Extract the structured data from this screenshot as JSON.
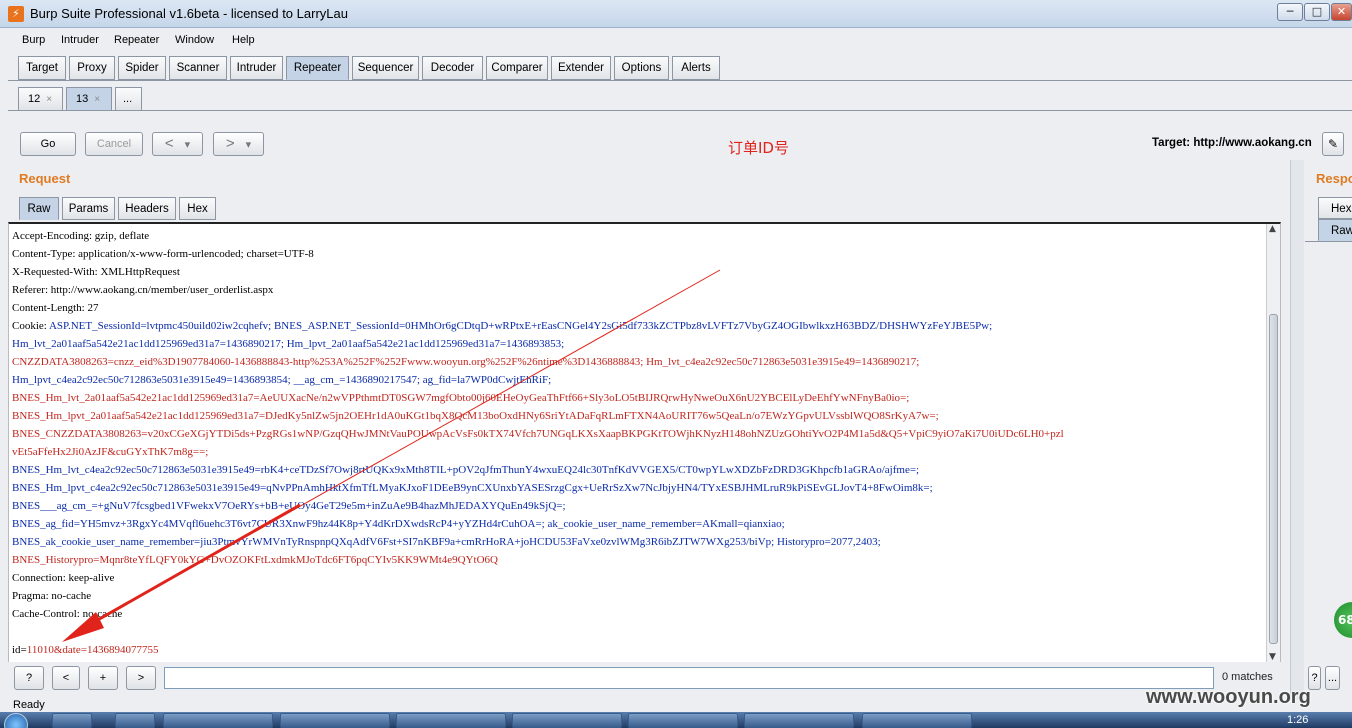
{
  "window": {
    "title": "Burp Suite Professional v1.6beta - licensed to LarryLau",
    "minimize": "─",
    "maximize": "□",
    "close": "✕"
  },
  "menu": [
    "Burp",
    "Intruder",
    "Repeater",
    "Window",
    "Help"
  ],
  "main_tabs": [
    "Target",
    "Proxy",
    "Spider",
    "Scanner",
    "Intruder",
    "Repeater",
    "Sequencer",
    "Decoder",
    "Comparer",
    "Extender",
    "Options",
    "Alerts"
  ],
  "active_main_tab": "Repeater",
  "sub_tabs": [
    {
      "label": "12",
      "close": "×"
    },
    {
      "label": "13",
      "close": "×"
    },
    {
      "label": "..."
    }
  ],
  "toolbar": {
    "go": "Go",
    "cancel": "Cancel",
    "back": "<",
    "forward": ">",
    "dropdown": "▾",
    "annotation": "订单ID号",
    "target": "Target: http://www.aokang.cn"
  },
  "request": {
    "title": "Request",
    "tabs": [
      "Raw",
      "Params",
      "Headers",
      "Hex"
    ],
    "active_tab": "Raw",
    "lines": [
      {
        "key": "Accept-Encoding:",
        "value": " gzip, deflate",
        "kc": "k",
        "vc": "k"
      },
      {
        "key": "Content-Type:",
        "value": " application/x-www-form-urlencoded; charset=UTF-8",
        "kc": "k",
        "vc": "k"
      },
      {
        "key": "X-Requested-With:",
        "value": " XMLHttpRequest",
        "kc": "k",
        "vc": "k"
      },
      {
        "key": "Referer:",
        "value": " http://www.aokang.cn/member/user_orderlist.aspx",
        "kc": "k",
        "vc": "k"
      },
      {
        "key": "Content-Length:",
        "value": " 27",
        "kc": "k",
        "vc": "k"
      },
      {
        "key": "Cookie: ",
        "value": "ASP.NET_SessionId=lvtpmc450uild02iw2cqhefv; BNES_ASP.NET_SessionId=0HMhOr6gCDtqD+wRPtxE+rEasCNGel4Y2sGi5df733kZCTPbz8vLVFTz7VbyGZ4OGIbwlkxzH63BDZ/DHSHWYzFeYJBE5Pw;",
        "kc": "k",
        "vc": "v"
      },
      {
        "key": "",
        "value": "Hm_lvt_2a01aaf5a542e21ac1dd125969ed31a7=1436890217; Hm_lpvt_2a01aaf5a542e21ac1dd125969ed31a7=1436893853;",
        "kc": "k",
        "vc": "v"
      },
      {
        "key": "",
        "value": "CNZZDATA3808263=cnzz_eid%3D1907784060-1436888843-http%253A%252F%252Fwww.wooyun.org%252F%26ntime%3D1436888843; Hm_lvt_c4ea2c92ec50c712863e5031e3915e49=1436890217;",
        "kc": "k",
        "vc": "r"
      },
      {
        "key": "",
        "value": "Hm_lpvt_c4ea2c92ec50c712863e5031e3915e49=1436893854; __ag_cm_=1436890217547; ag_fid=la7WP0dCwjtEhRiF;",
        "kc": "k",
        "vc": "v"
      },
      {
        "key": "",
        "value": "BNES_Hm_lvt_2a01aaf5a542e21ac1dd125969ed31a7=AeUUXacNe/n2wVPPthmtDT0SGW7mgfObto00j60EHeOyGeaThFtf66+Sly3oLO5tBIJRQrwHyNweOuX6nU2YBCElLyDeEhfYwNFnyBa0io=;",
        "kc": "k",
        "vc": "r"
      },
      {
        "key": "",
        "value": "BNES_Hm_lpvt_2a01aaf5a542e21ac1dd125969ed31a7=DJedKy5nlZw5jn2OEHr1dA0uKGt1bqX8QcM13boOxdHNy6SriYtADaFqRLmFTXN4AoURIT76w5QeaLn/o7EWzYGpvULVssblWQO8SrKyA7w=;",
        "kc": "k",
        "vc": "r"
      },
      {
        "key": "",
        "value": "BNES_CNZZDATA3808263=v20xCGeXGjYTDi5ds+PzgRGs1wNP/GzqQHwJMNtVauPOUwpAcVsFs0kTX74Vfch7UNGqLKXsXaapBKPGKtTOWjhKNyzH148ohNZUzGOhtiYvO2P4M1a5d&Q5+VpiC9yiO7aKi7U0iUDc6LH0+pzl",
        "kc": "k",
        "vc": "r"
      },
      {
        "key": "",
        "value": "vEt5aFfeHx2Ji0AzJF&cuGYxThK7m8g==;",
        "kc": "k",
        "vc": "r"
      },
      {
        "key": "",
        "value": "BNES_Hm_lvt_c4ea2c92ec50c712863e5031e3915e49=rbK4+ceTDzSf7Owj8rtUQKx9xMth8TIL+pOV2qJfmThunY4wxuEQ24lc30TnfKdVVGEX5/CT0wpYLwXDZbFzDRD3GKhpcfb1aGRAo/ajfme=;",
        "kc": "k",
        "vc": "v"
      },
      {
        "key": "",
        "value": "BNES_Hm_lpvt_c4ea2c92ec50c712863e5031e3915e49=qNvPPnAmhHktXfmTfLMyaKJxoF1DEeB9ynCXUnxbYASESrzgCgx+UeRrSzXw7NcJbjyHN4/TYxESBJHMLruR9kPiSEvGLJovT4+8FwOim8k=;",
        "kc": "k",
        "vc": "v"
      },
      {
        "key": "",
        "value": "BNES___ag_cm_=+gNuV7fcsgbed1VFwekxV7OeRYs+bB+eUOy4GeT29e5m+inZuAe9B4hazMhJEDAXYQuEn49kSjQ=;",
        "kc": "k",
        "vc": "v"
      },
      {
        "key": "",
        "value": "BNES_ag_fid=YH5mvz+3RgxYc4MVqfl6uehc3T6vt7CUR3XnwF9hz44K8p+Y4dKrDXwdsRcP4+yYZHd4rCuhOA=; ak_cookie_user_name_remember=AKmall=qianxiao;",
        "kc": "k",
        "vc": "v"
      },
      {
        "key": "",
        "value": "BNES_ak_cookie_user_name_remember=jiu3PtmvYrWMVnTyRnspnpQXqAdfV6Fst+SI7nKBF9a+cmRrHoRA+joHCDU53FaVxe0zvlWMg3R6ibZJTW7WXg253/biVp; Historypro=2077,2403;",
        "kc": "k",
        "vc": "v"
      },
      {
        "key": "",
        "value": "BNES_Historypro=Mqnr8teYfLQFY0kYG+DvOZOKFtLxdmkMJoTdc6FT6pqCYIv5KK9WMt4e9QYtO6Q",
        "kc": "k",
        "vc": "r"
      },
      {
        "key": "Connection:",
        "value": " keep-alive",
        "kc": "k",
        "vc": "k"
      },
      {
        "key": "Pragma:",
        "value": " no-cache",
        "kc": "k",
        "vc": "k"
      },
      {
        "key": "Cache-Control:",
        "value": " no-cache",
        "kc": "k",
        "vc": "k"
      },
      {
        "key": "",
        "value": "",
        "kc": "k",
        "vc": "k"
      },
      {
        "key": "id=",
        "value": "11010&date=1436894077755",
        "kc": "k",
        "vc": "r"
      }
    ]
  },
  "search": {
    "help": "?",
    "prev": "<",
    "add": "+",
    "next": ">",
    "value": "",
    "matches": "0 matches"
  },
  "status": "Ready",
  "response": {
    "title": "Respo",
    "tabs": [
      "Hex",
      "Raw"
    ],
    "help": "?",
    "more": "...",
    "badge": "68"
  },
  "taskbar": {
    "clock": "1:26"
  },
  "watermark": "www.wooyun.org",
  "colors": {
    "accent_orange": "#e07b22",
    "annotation_red": "#e0241b",
    "param_blue": "#0a2ba8",
    "param_red": "#c0261e"
  }
}
